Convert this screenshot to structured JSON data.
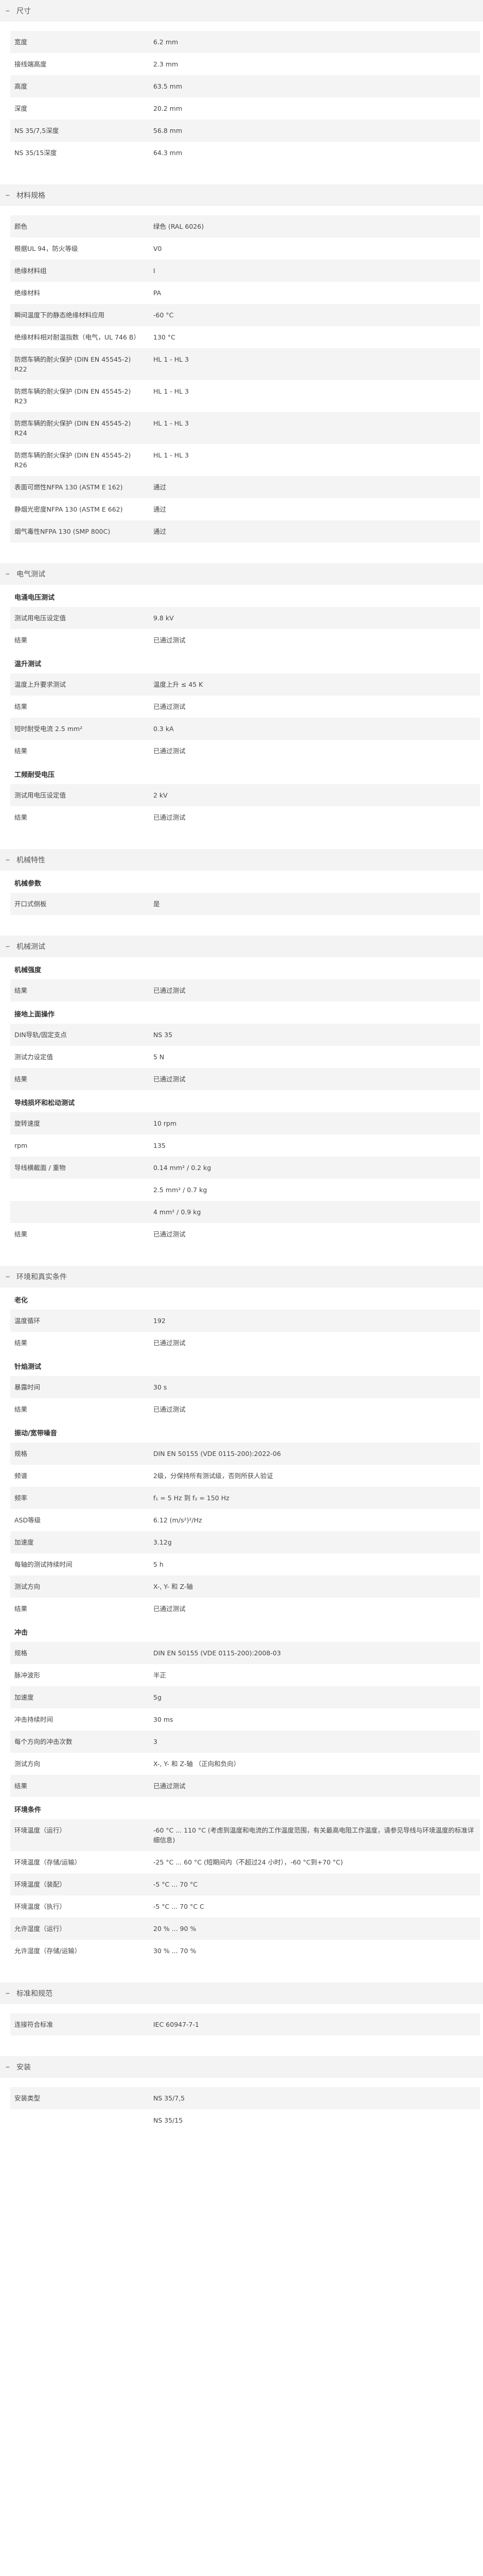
{
  "sections": [
    {
      "title": "尺寸",
      "groups": [
        {
          "heading": "",
          "rows": [
            {
              "k": "宽度",
              "v": "6.2 mm"
            },
            {
              "k": "接线端高度",
              "v": "2.3 mm"
            },
            {
              "k": "高度",
              "v": "63.5 mm"
            },
            {
              "k": "深度",
              "v": "20.2 mm"
            },
            {
              "k": "NS 35/7,5深度",
              "v": "56.8 mm"
            },
            {
              "k": "NS 35/15深度",
              "v": "64.3 mm"
            }
          ]
        }
      ]
    },
    {
      "title": "材料规格",
      "groups": [
        {
          "heading": "",
          "rows": [
            {
              "k": "颜色",
              "v": "绿色 (RAL 6026)"
            },
            {
              "k": "根据UL 94，防火等级",
              "v": "V0"
            },
            {
              "k": "绝缘材料组",
              "v": "I"
            },
            {
              "k": "绝缘材料",
              "v": "PA"
            },
            {
              "k": "瞬间温度下的静态绝缘材料应用",
              "v": "-60 °C"
            },
            {
              "k": "绝缘材料相对耐温指数（电气，UL 746 B）",
              "v": "130 °C"
            },
            {
              "k": "防燃车辆的耐火保护 (DIN EN 45545-2) R22",
              "v": "HL 1 - HL 3"
            },
            {
              "k": "防燃车辆的耐火保护 (DIN EN 45545-2) R23",
              "v": "HL 1 - HL 3"
            },
            {
              "k": "防燃车辆的耐火保护 (DIN EN 45545-2) R24",
              "v": "HL 1 - HL 3"
            },
            {
              "k": "防燃车辆的耐火保护 (DIN EN 45545-2) R26",
              "v": "HL 1 - HL 3"
            },
            {
              "k": "表面可燃性NFPA 130 (ASTM E 162)",
              "v": "通过"
            },
            {
              "k": "静烟光密度NFPA 130 (ASTM E 662)",
              "v": "通过"
            },
            {
              "k": "烟气毒性NFPA 130 (SMP 800C)",
              "v": "通过"
            }
          ]
        }
      ]
    },
    {
      "title": "电气测试",
      "groups": [
        {
          "heading": "电涌电压测试",
          "rows": [
            {
              "k": "测试用电压设定值",
              "v": "9.8 kV"
            },
            {
              "k": "结果",
              "v": "已通过测试"
            }
          ]
        },
        {
          "heading": "温升测试",
          "rows": [
            {
              "k": "温度上升要求测试",
              "v": "温度上升 ≤ 45 K"
            },
            {
              "k": "结果",
              "v": "已通过测试"
            },
            {
              "k": "短时耐受电流 2.5 mm²",
              "v": "0.3 kA"
            },
            {
              "k": "结果",
              "v": "已通过测试"
            }
          ]
        },
        {
          "heading": "工频耐受电压",
          "rows": [
            {
              "k": "测试用电压设定值",
              "v": "2 kV"
            },
            {
              "k": "结果",
              "v": "已通过测试"
            }
          ]
        }
      ]
    },
    {
      "title": "机械特性",
      "groups": [
        {
          "heading": "机械参数",
          "rows": [
            {
              "k": "开口式侧板",
              "v": "是"
            }
          ]
        }
      ]
    },
    {
      "title": "机械测试",
      "groups": [
        {
          "heading": "机械强度",
          "rows": [
            {
              "k": "结果",
              "v": "已通过测试"
            }
          ]
        },
        {
          "heading": "接地上面操作",
          "rows": [
            {
              "k": "DIN导轨/固定支点",
              "v": "NS 35"
            },
            {
              "k": "测试力设定值",
              "v": "5 N"
            },
            {
              "k": "结果",
              "v": "已通过测试"
            }
          ]
        },
        {
          "heading": "导线损坏和松动测试",
          "rows": [
            {
              "k": "旋转速度",
              "v": "10 rpm"
            },
            {
              "k": "rpm",
              "v": "135"
            },
            {
              "k": "导线横截面 / 重物",
              "v": "0.14 mm² / 0.2 kg"
            },
            {
              "k": "",
              "v": "2.5 mm² / 0.7 kg"
            },
            {
              "k": "",
              "v": "4 mm² / 0.9 kg"
            },
            {
              "k": "结果",
              "v": "已通过测试"
            }
          ]
        }
      ]
    },
    {
      "title": "环境和真实条件",
      "groups": [
        {
          "heading": "老化",
          "rows": [
            {
              "k": "温度循环",
              "v": "192"
            },
            {
              "k": "结果",
              "v": "已通过测试"
            }
          ]
        },
        {
          "heading": "针焰测试",
          "rows": [
            {
              "k": "暴露时间",
              "v": "30 s"
            },
            {
              "k": "结果",
              "v": "已通过测试"
            }
          ]
        },
        {
          "heading": "振动/宽带噪音",
          "rows": [
            {
              "k": "规格",
              "v": "DIN EN 50155 (VDE 0115-200):2022-06"
            },
            {
              "k": "频谱",
              "v": "2级，分保持所有测试级，否则所获人验证"
            },
            {
              "k": "频率",
              "v": "f₁ = 5 Hz 到 f₂ = 150 Hz"
            },
            {
              "k": "ASD等级",
              "v": "6.12 (m/s²)²/Hz"
            },
            {
              "k": "加速度",
              "v": "3.12g"
            },
            {
              "k": "每轴的测试持续时间",
              "v": "5 h"
            },
            {
              "k": "测试方向",
              "v": "X-, Y- 和 Z-轴"
            },
            {
              "k": "结果",
              "v": "已通过测试"
            }
          ]
        },
        {
          "heading": "冲击",
          "rows": [
            {
              "k": "规格",
              "v": "DIN EN 50155 (VDE 0115-200):2008-03"
            },
            {
              "k": "脉冲波形",
              "v": "半正"
            },
            {
              "k": "加速度",
              "v": "5g"
            },
            {
              "k": "冲击持续时间",
              "v": "30 ms"
            },
            {
              "k": "每个方向的冲击次数",
              "v": "3"
            },
            {
              "k": "测试方向",
              "v": "X-, Y- 和 Z-轴 （正向和负向）"
            },
            {
              "k": "结果",
              "v": "已通过测试"
            }
          ]
        },
        {
          "heading": "环境条件",
          "rows": [
            {
              "k": "环境温度（运行）",
              "v": "-60 °C ... 110 °C (考虑到温度和电流的工作温度范围，有关最高电阻工作温度，请参见导线与环境温度的标准详细信息)"
            },
            {
              "k": "环境温度（存储/运输）",
              "v": "-25 °C ... 60 °C (短期间内（不超过24 小时），-60 °C到+70 °C)"
            },
            {
              "k": "环境温度（装配）",
              "v": "-5 °C ... 70 °C"
            },
            {
              "k": "环境温度（执行）",
              "v": "-5 °C ... 70 °C C"
            },
            {
              "k": "允许湿度（运行）",
              "v": "20 % ... 90 %"
            },
            {
              "k": "允许湿度（存储/运输）",
              "v": "30 % ... 70 %"
            }
          ]
        }
      ]
    },
    {
      "title": "标准和规范",
      "groups": [
        {
          "heading": "",
          "rows": [
            {
              "k": "连接符合标准",
              "v": "IEC 60947-7-1"
            }
          ]
        }
      ]
    },
    {
      "title": "安装",
      "groups": [
        {
          "heading": "",
          "rows": [
            {
              "k": "安装类型",
              "v": "NS 35/7,5"
            },
            {
              "k": "",
              "v": "NS 35/15"
            }
          ]
        }
      ]
    }
  ]
}
